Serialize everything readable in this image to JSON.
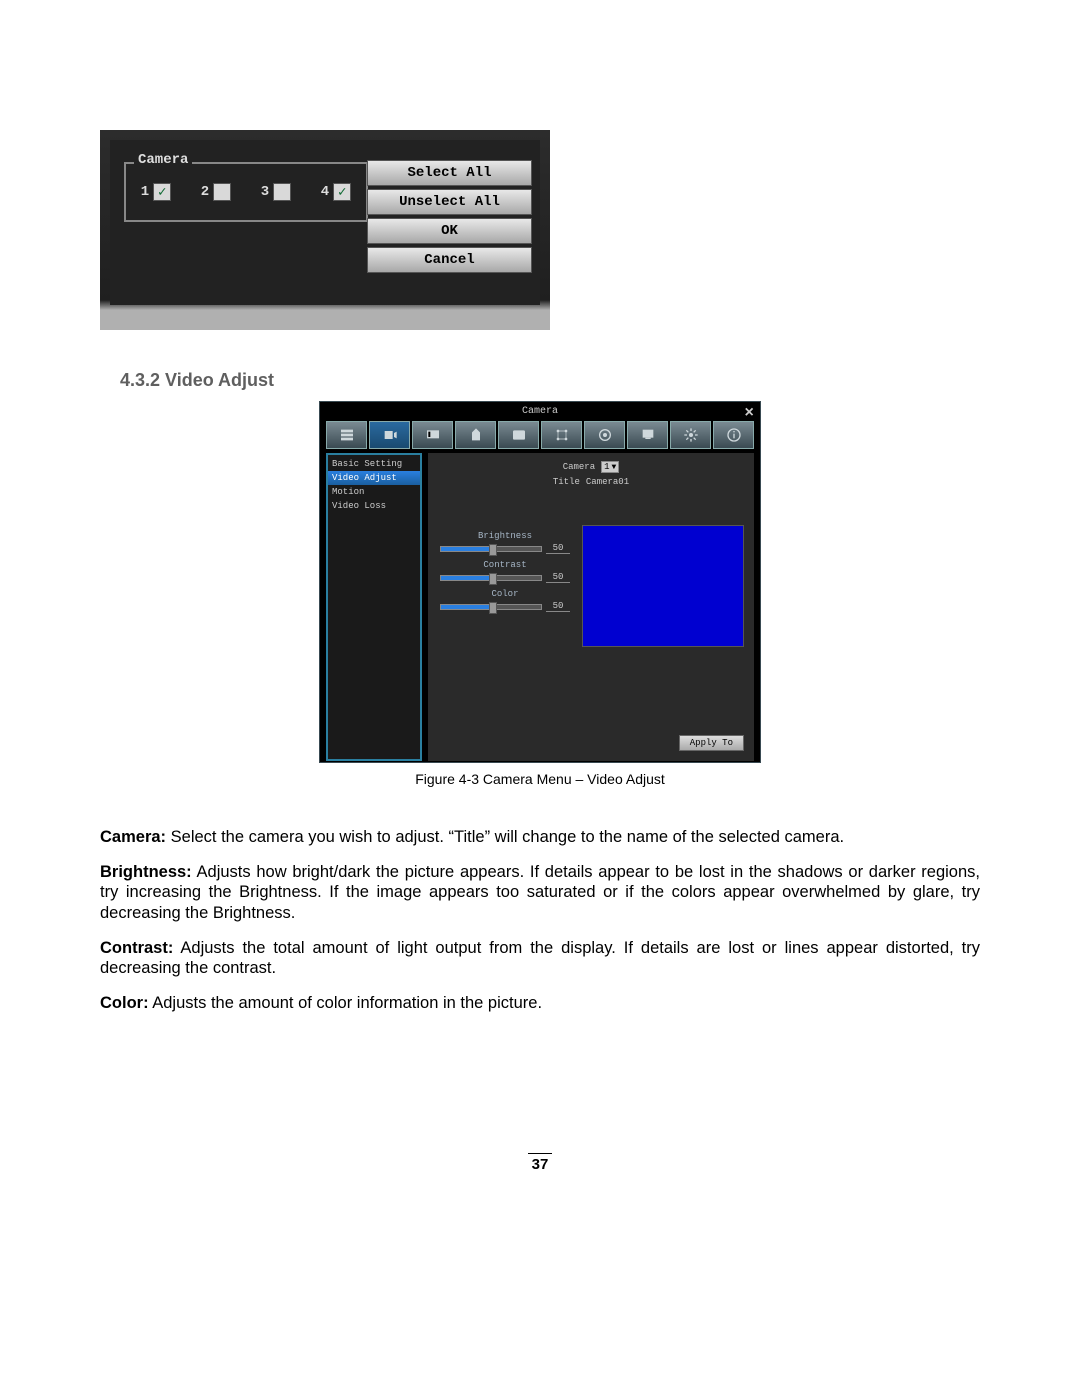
{
  "shot1": {
    "legend": "Camera",
    "items": [
      {
        "label": "1",
        "checked": true
      },
      {
        "label": "2",
        "checked": false
      },
      {
        "label": "3",
        "checked": false
      },
      {
        "label": "4",
        "checked": true
      }
    ],
    "buttons": {
      "select_all": "Select All",
      "unselect_all": "Unselect All",
      "ok": "OK",
      "cancel": "Cancel"
    }
  },
  "section_heading": "4.3.2  Video Adjust",
  "shot2": {
    "window_title": "Camera",
    "sidebar": [
      {
        "label": "Basic Setting",
        "selected": false
      },
      {
        "label": "Video Adjust",
        "selected": true
      },
      {
        "label": "Motion",
        "selected": false
      },
      {
        "label": "Video Loss",
        "selected": false
      }
    ],
    "camera_label": "Camera",
    "camera_value": "1",
    "title_label": "Title",
    "title_value": "Camera01",
    "sliders": {
      "brightness": {
        "label": "Brightness",
        "value": "50"
      },
      "contrast": {
        "label": "Contrast",
        "value": "50"
      },
      "color": {
        "label": "Color",
        "value": "50"
      }
    },
    "apply_label": "Apply To"
  },
  "figure_caption": "Figure 4-3  Camera Menu – Video Adjust",
  "paragraphs": {
    "camera_b": "Camera:",
    "camera_t": " Select the camera you wish to adjust. “Title” will change to the name of the selected camera.",
    "bright_b": "Brightness:",
    "bright_t": " Adjusts how bright/dark the picture appears.  If details appear to be lost in the shadows or darker regions, try increasing the Brightness.  If the image appears too saturated or if the colors appear overwhelmed by glare, try decreasing the Brightness.",
    "contrast_b": "Contrast:",
    "contrast_t": " Adjusts the total amount of light output from the display. If details are lost or lines appear distorted, try decreasing the contrast.",
    "color_b": "Color:",
    "color_t": " Adjusts the amount of color information in the picture."
  },
  "page_number": "37"
}
